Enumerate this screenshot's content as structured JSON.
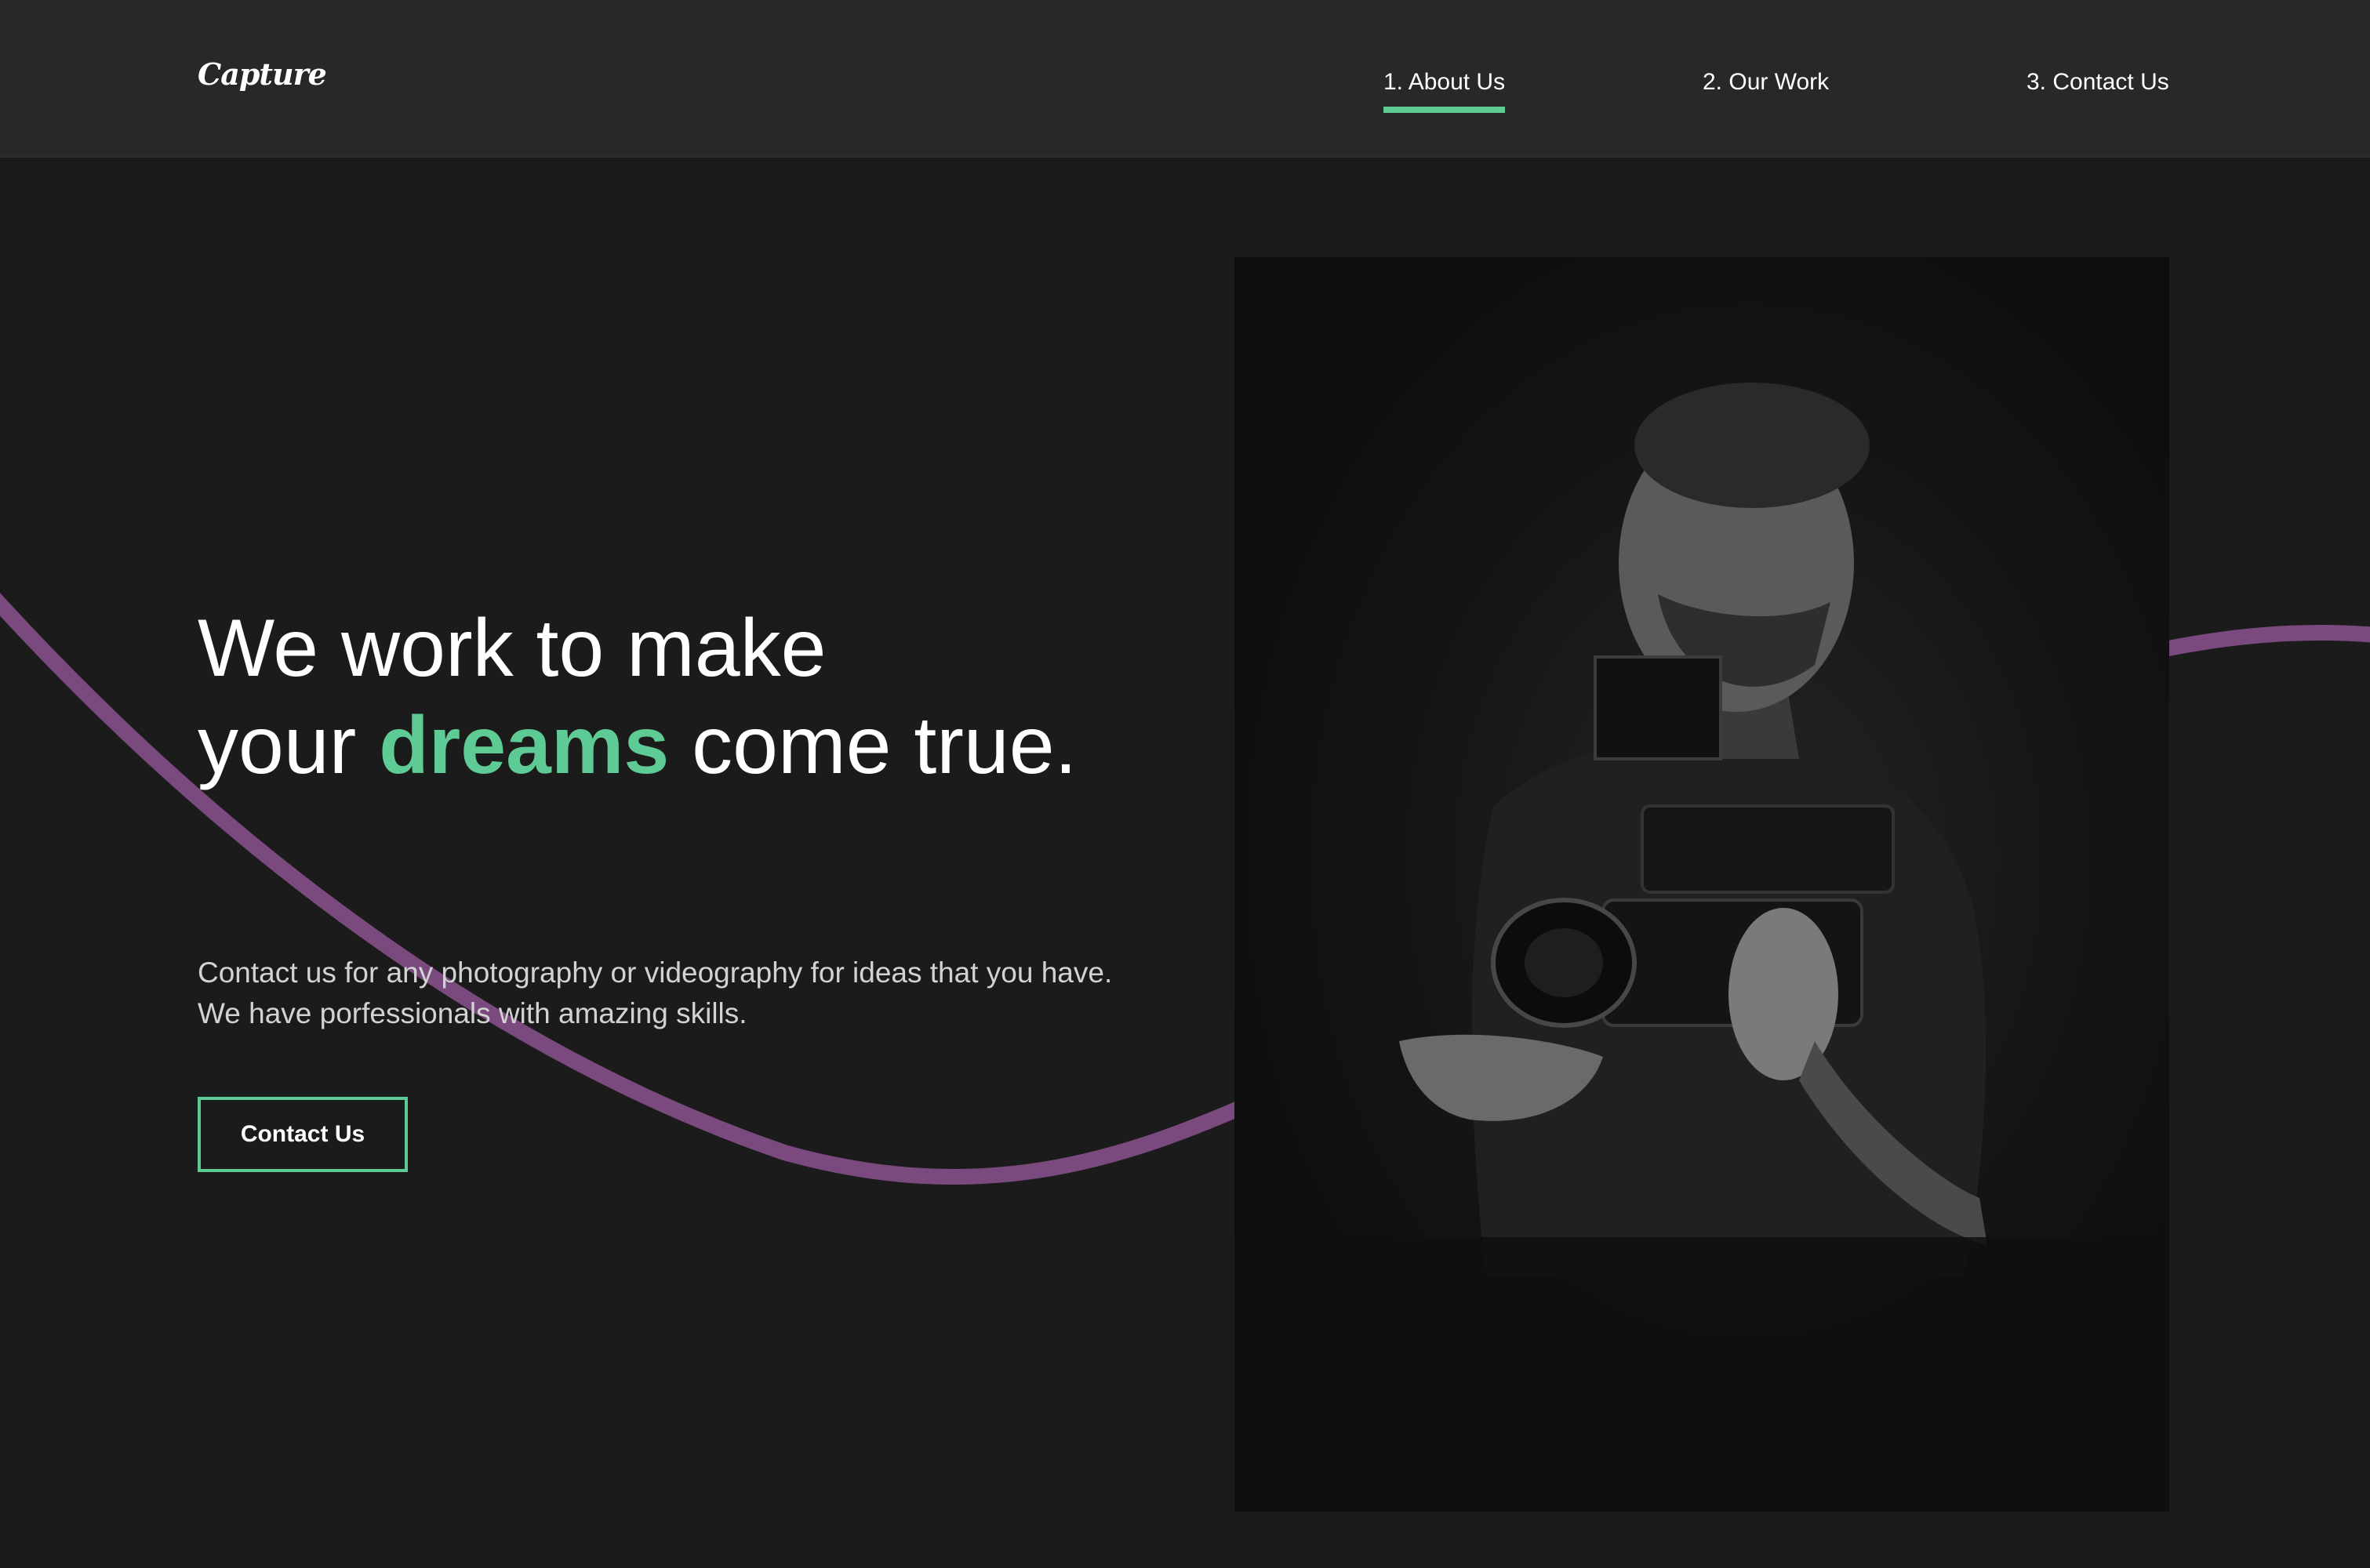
{
  "nav": {
    "logo": "Capture",
    "items": [
      {
        "label": "1. About Us",
        "active": true
      },
      {
        "label": "2. Our Work",
        "active": false
      },
      {
        "label": "3. Contact Us",
        "active": false
      }
    ]
  },
  "hero": {
    "title_line1": "We work to make",
    "title_your": "your ",
    "title_accent": "dreams",
    "title_rest": " come true.",
    "description": "Contact us for any photography or videography for ideas that you have. We have porfessionals with amazing skills.",
    "button_label": "Contact Us",
    "image_icon": "videographer-photo"
  },
  "colors": {
    "background": "#1b1b1c",
    "navbar": "#282828",
    "accent_green": "#5ecb95",
    "curve_purple": "#7a4a7e",
    "text": "#ffffff"
  }
}
